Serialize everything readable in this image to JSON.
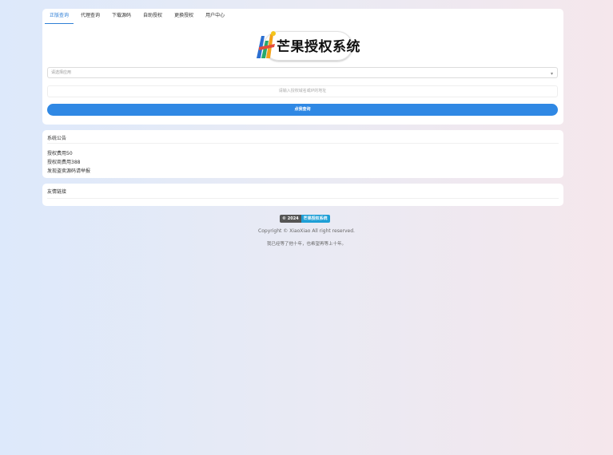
{
  "tabs": [
    {
      "label": "正版查询",
      "active": true
    },
    {
      "label": "代理查询",
      "active": false
    },
    {
      "label": "下载源码",
      "active": false
    },
    {
      "label": "自助授权",
      "active": false
    },
    {
      "label": "更换授权",
      "active": false
    },
    {
      "label": "用户中心",
      "active": false
    }
  ],
  "logo": {
    "text": "芒果授权系统"
  },
  "query": {
    "select_value": "请选择应用",
    "domain_placeholder": "请输入授权域名或IP的地址",
    "submit_label": "点我查询"
  },
  "notice": {
    "title": "系统公告",
    "lines": [
      "授权费用50",
      "授权商费用388",
      "发现盗卖源码请举报"
    ]
  },
  "links": {
    "title": "友情链接"
  },
  "footer": {
    "badge_year": "© 2024",
    "badge_name": "芒果授权系统",
    "copyright": "Copyright © XiaoXiao All right reserved.",
    "slogan": "我已经等了他十年，也希望再等上十年。"
  },
  "colors": {
    "accent": "#2f88e4",
    "tab_active": "#2f7fd6"
  }
}
